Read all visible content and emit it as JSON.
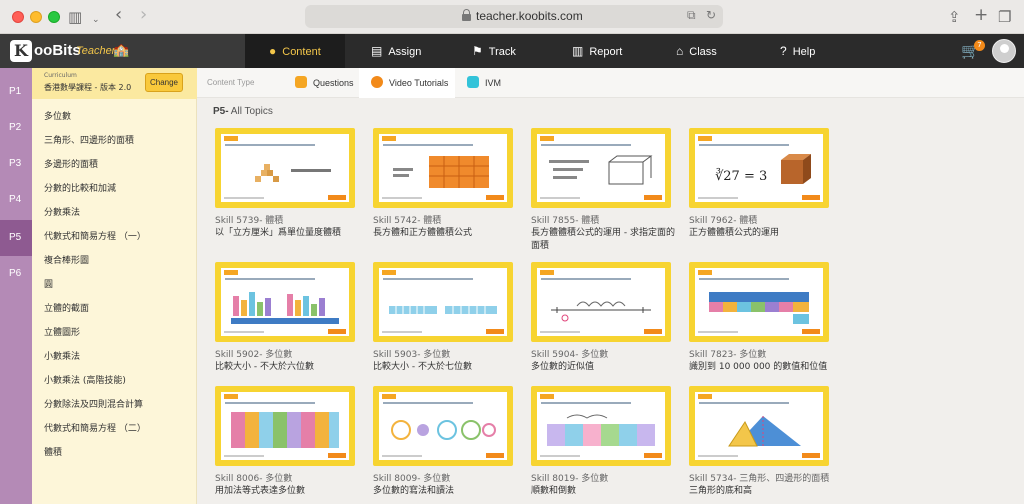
{
  "browser": {
    "url": "teacher.koobits.com"
  },
  "brand": {
    "logo_letter": "K",
    "name": "ooBits",
    "tagline": "Teacher"
  },
  "nav": [
    {
      "label": "Content",
      "icon": "search-icon",
      "glyph": "🔍"
    },
    {
      "label": "Assign",
      "icon": "assign-icon",
      "glyph": "▤"
    },
    {
      "label": "Track",
      "icon": "track-icon",
      "glyph": "⚑"
    },
    {
      "label": "Report",
      "icon": "report-icon",
      "glyph": "▥"
    },
    {
      "label": "Class",
      "icon": "class-icon",
      "glyph": "⛺"
    },
    {
      "label": "Help",
      "icon": "help-icon",
      "glyph": "?"
    }
  ],
  "cart_count": "7",
  "grades": [
    "P1",
    "P2",
    "P3",
    "P4",
    "P5",
    "P6"
  ],
  "active_grade": "P5",
  "curriculum": {
    "label": "Curriculum",
    "value": "香港數學課程 - 版本 2.0",
    "change": "Change"
  },
  "topics": [
    "多位數",
    "三角形、四邊形的面積",
    "多邊形的面積",
    "分數的比較和加減",
    "分數乘法",
    "代數式和簡易方程 （一）",
    "複合棒形圖",
    "圓",
    "立體的截面",
    "立體圖形",
    "小數乘法",
    "小數乘法 (高階技能)",
    "分數除法及四則混合計算",
    "代數式和簡易方程 （二）",
    "體積"
  ],
  "content_type": {
    "label": "Content Type",
    "tabs": [
      {
        "label": "Questions",
        "icon": "questions-icon"
      },
      {
        "label": "Video Tutorials",
        "icon": "video-icon"
      },
      {
        "label": "IVM",
        "icon": "ivm-icon"
      }
    ],
    "active": "Video Tutorials"
  },
  "heading": {
    "grade": "P5-",
    "label": "All Topics"
  },
  "cards": [
    {
      "skill": "Skill 5739- 體積",
      "title": "以「立方厘米」爲單位量度體積"
    },
    {
      "skill": "Skill 5742- 體積",
      "title": "長方體和正方體體積公式"
    },
    {
      "skill": "Skill 7855- 體積",
      "title": "長方體體積公式的運用 - 求指定面的面積"
    },
    {
      "skill": "Skill 7962- 體積",
      "title": "正方體體積公式的運用"
    },
    {
      "skill": "Skill 5902- 多位數",
      "title": "比較大小 - 不大於六位數"
    },
    {
      "skill": "Skill 5903- 多位數",
      "title": "比較大小 - 不大於七位數"
    },
    {
      "skill": "Skill 5904- 多位數",
      "title": "多位數的近似值"
    },
    {
      "skill": "Skill 7823- 多位數",
      "title": "識別到 10 000 000 的數值和位值"
    },
    {
      "skill": "Skill 8006- 多位數",
      "title": "用加法等式表達多位數"
    },
    {
      "skill": "Skill 8009- 多位數",
      "title": "多位數的寫法和讀法"
    },
    {
      "skill": "Skill 8019- 多位數",
      "title": "順數和倒數"
    },
    {
      "skill": "Skill 5734- 三角形、四邊形的面積",
      "title": "三角形的底和高"
    }
  ]
}
